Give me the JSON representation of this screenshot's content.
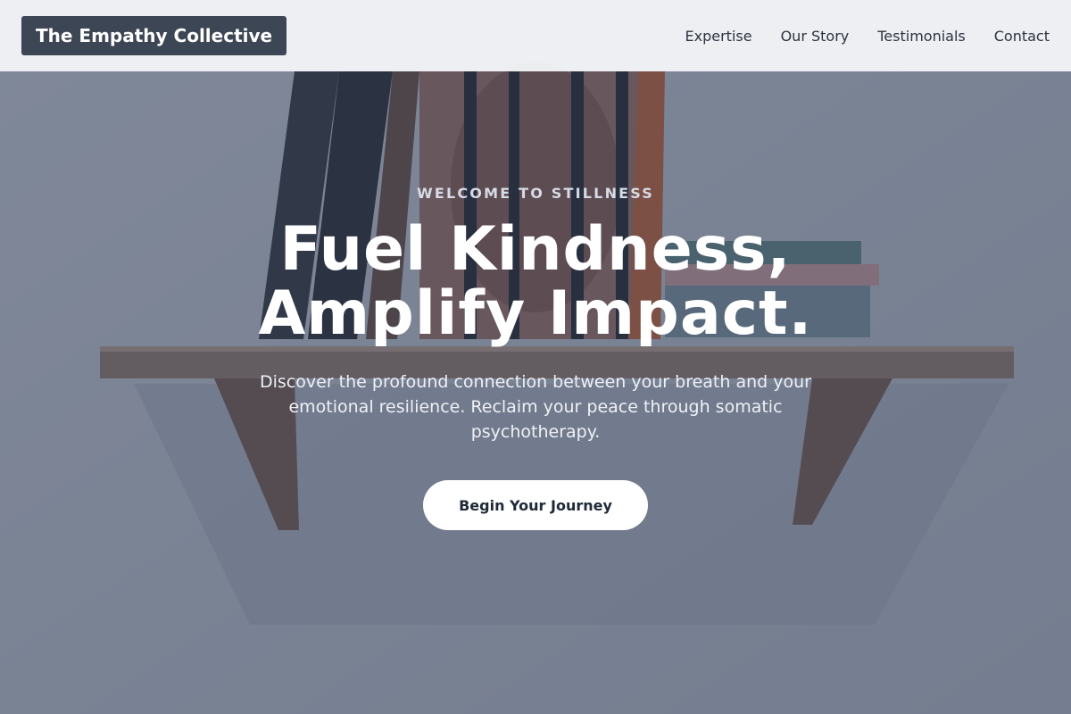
{
  "header": {
    "brand": "The Empathy Collective",
    "nav": [
      {
        "label": "Expertise"
      },
      {
        "label": "Our Story"
      },
      {
        "label": "Testimonials"
      },
      {
        "label": "Contact"
      }
    ]
  },
  "hero": {
    "eyebrow": "WELCOME TO STILLNESS",
    "headline_line1": "Fuel Kindness,",
    "headline_line2": "Amplify Impact.",
    "subtext": "Discover the profound connection between your breath and your emotional resilience. Reclaim your peace through somatic psychotherapy.",
    "cta_label": "Begin Your Journey"
  },
  "colors": {
    "header_bg": "#f3f4f6",
    "brand_bg": "#3d4654",
    "overlay": "#37415a",
    "cta_bg": "#ffffff",
    "cta_text": "#1f2937"
  }
}
